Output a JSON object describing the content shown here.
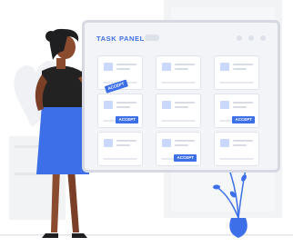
{
  "task_panel": {
    "title": "TASK PANEL",
    "cards": [
      {
        "button": null
      },
      {
        "button": null
      },
      {
        "button": null
      },
      {
        "button": "ACCEPT"
      },
      {
        "button": null
      },
      {
        "button": "ACCEPT"
      },
      {
        "button": null
      },
      {
        "button": "ACCEPT"
      },
      {
        "button": null
      }
    ]
  },
  "held_card": {
    "button": "ACCEPT"
  },
  "colors": {
    "accent": "#3d6fe8",
    "dress": "#3d6fe8",
    "top": "#222222",
    "skin": "#8a4b2f",
    "hair": "#1f1f22",
    "plant": "#3d6fe8",
    "background_shapes": "#f2f3f5"
  },
  "icons": [
    "window-dot-icon",
    "card-thumbnail-icon",
    "plant-icon",
    "vase-icon"
  ]
}
